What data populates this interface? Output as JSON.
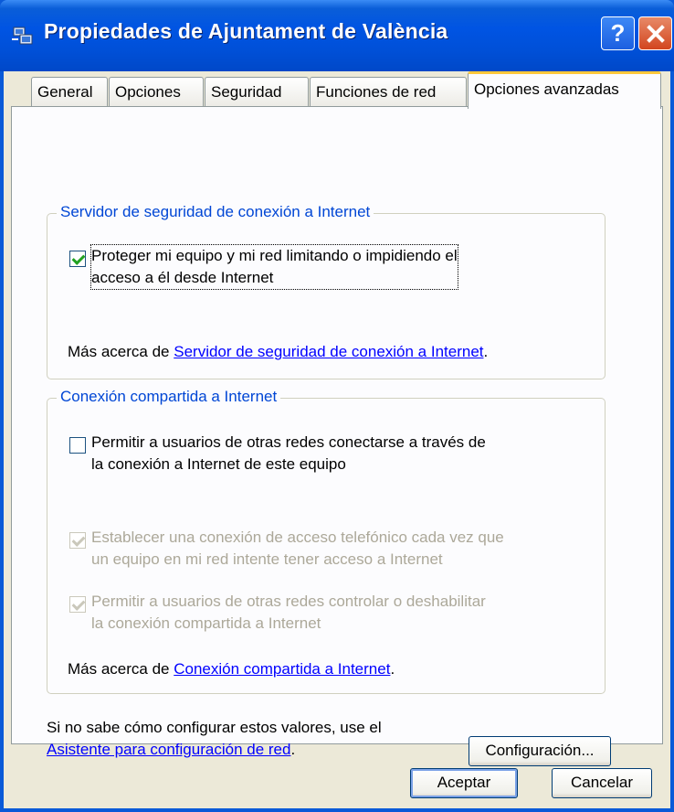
{
  "window": {
    "title": "Propiedades de Ajuntament de València",
    "help_label": "?",
    "close_label": "✕"
  },
  "tabs": [
    {
      "label": "General"
    },
    {
      "label": "Opciones"
    },
    {
      "label": "Seguridad"
    },
    {
      "label": "Funciones de red"
    },
    {
      "label": "Opciones avanzadas",
      "active": true
    }
  ],
  "firewall": {
    "legend": "Servidor de seguridad de conexión a Internet",
    "checkbox_line1": "Proteger mi equipo y mi red limitando o impidiendo el",
    "checkbox_line2": "acceso a él desde Internet",
    "checked": true,
    "more_prefix": "Más acerca de ",
    "more_link": "Servidor de seguridad de conexión a Internet",
    "more_suffix": "."
  },
  "ics": {
    "legend": "Conexión compartida a Internet",
    "allow_line1": "Permitir a usuarios de otras redes conectarse a  través de",
    "allow_line2": "la conexión a Internet de este equipo",
    "allow_checked": false,
    "dial_line1": "Establecer una conexión de acceso telefónico cada vez que",
    "dial_line2": "un equipo en mi red intente tener acceso a Internet",
    "dial_checked": true,
    "control_line1": "Permitir a usuarios de otras redes controlar o deshabilitar",
    "control_line2": "la conexión compartida a Internet",
    "control_checked": true,
    "more_prefix": "Más acerca de ",
    "more_link": "Conexión compartida a Internet",
    "more_suffix": "."
  },
  "footer": {
    "hint_line1": "Si no sabe cómo configurar estos valores, use el",
    "wizard_link": "Asistente para configuración de red",
    "hint_suffix": ".",
    "config_button": "Configuración..."
  },
  "buttons": {
    "ok": "Aceptar",
    "cancel": "Cancelar"
  },
  "colors": {
    "titlebar": "#0054e3",
    "group_legend": "#0046d5",
    "link": "#0000ff",
    "active_tab_accent": "#ffc83c"
  }
}
